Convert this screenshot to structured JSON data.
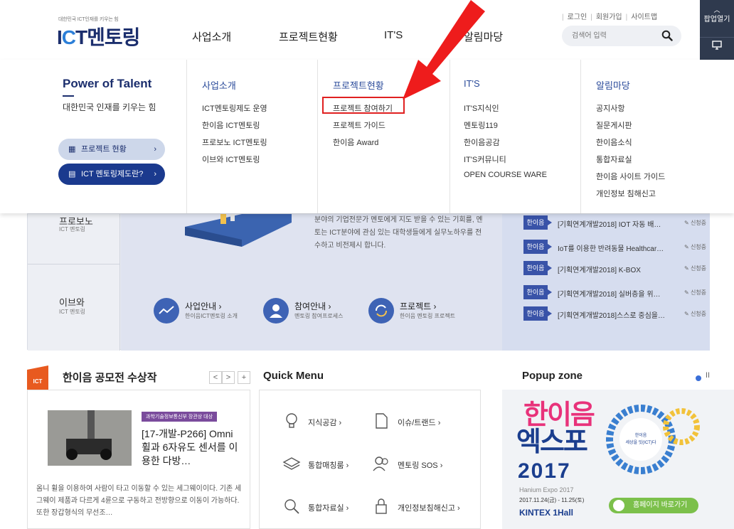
{
  "header": {
    "logo_sub": "대한민국 ICT인재를 키우는 힘",
    "logo_ict_i": "I",
    "logo_ict_c": "C",
    "logo_ict_t": "T",
    "logo_mentoring": "멘토링",
    "gnb": [
      "사업소개",
      "프로젝트현황",
      "IT'S",
      "알림마당"
    ],
    "util": [
      "로그인",
      "회원가입",
      "사이트맵"
    ],
    "search_placeholder": "검색어 입력",
    "popup_open": "팝업열기"
  },
  "mega": {
    "intro_title": "Power of Talent",
    "intro_sub": "대한민국 인재를 키우는 힘",
    "pill_status": "프로젝트 현황",
    "pill_what": "ICT 멘토링제도란?",
    "columns": [
      {
        "title": "사업소개",
        "items": [
          "ICT멘토링제도 운영",
          "한이음 ICT멘토링",
          "프로보노 ICT멘토링",
          "이브와 ICT멘토링"
        ]
      },
      {
        "title": "프로젝트현황",
        "items": [
          "프로젝트 참여하기",
          "프로젝트 가이드",
          "한이음 Award"
        ]
      },
      {
        "title": "IT'S",
        "items": [
          "IT'S지식인",
          "멘토링119",
          "한이음공감",
          "IT'S커뮤니티",
          "OPEN COURSE WARE"
        ]
      },
      {
        "title": "알림마당",
        "items": [
          "공지사항",
          "질문게시판",
          "한이음소식",
          "통합자료실",
          "한이음 사이트 가이드",
          "개인정보 침해신고"
        ]
      }
    ]
  },
  "banner": {
    "probono_title": "프로보노",
    "probono_sub": "ICT 멘토링",
    "eve_title": "이브와",
    "eve_sub": "ICT 멘토링",
    "desc": "분야의 기업전문가 멘토에게 지도 받을 수 있는 기회를, 멘토는 ICT분야에 관심 있는 대학생들에게 실무노하우를 전수하고 비전제시 합니다.",
    "services": [
      {
        "title": "사업안내 ›",
        "sub": "한이음ICT멘토링 소개"
      },
      {
        "title": "참여안내 ›",
        "sub": "멘토링 참여프로세스"
      },
      {
        "title": "프로젝트 ›",
        "sub": "한이음 멘토링 프로젝트"
      }
    ],
    "news": [
      {
        "tag": "한이음",
        "text": "[기획연계개발2018] IOT 자동 배…",
        "status": "신청중"
      },
      {
        "tag": "한이음",
        "text": "IoT를 이용한 반려동물 Healthcar…",
        "status": "신청중"
      },
      {
        "tag": "한이음",
        "text": "[기획연계개발2018] K-BOX",
        "status": "신청중"
      },
      {
        "tag": "한이음",
        "text": "[기획연계개발2018] 실버층을 위…",
        "status": "신청중"
      },
      {
        "tag": "한이음",
        "text": "[기획연계개발2018]스스로 중심을…",
        "status": "신청중"
      }
    ]
  },
  "hanium": {
    "badge": "ICT",
    "title": "한이음 공모전 수상작",
    "nav": [
      "<",
      ">",
      "+"
    ],
    "card_tag": "과학기술정보통신부 장관상 대상",
    "card_title": "[17-개발-P266] Omni 휠과 6자유도 센서를 이용한 다방…",
    "card_desc": "옴니 휠을 이용하여 사람이 타고 이동할 수 있는 세그웨이이다. 기존 세그웨이 제품과 다르게 4륜으로 구동하고 전방향으로 이동이 가능하다. 또한 장갑형식의 무선조…"
  },
  "quick": {
    "title": "Quick Menu",
    "items": [
      {
        "label": "지식공감 ›",
        "icon": "lightbulb-icon"
      },
      {
        "label": "이슈/트랜드 ›",
        "icon": "document-icon"
      },
      {
        "label": "통합매칭룸 ›",
        "icon": "layers-icon"
      },
      {
        "label": "멘토링 SOS ›",
        "icon": "people-icon"
      },
      {
        "label": "통합자료실 ›",
        "icon": "search-icon"
      },
      {
        "label": "개인정보침해신고 ›",
        "icon": "lock-icon"
      }
    ]
  },
  "popup": {
    "title": "Popup zone",
    "pause": "II",
    "expo_han": "한이음",
    "expo_ex": "엑스포",
    "expo_year": "2017",
    "expo_en": "Hanium Expo 2017",
    "expo_date": "2017.11.24(금) - 11.25(토)",
    "expo_venue": "KINTEX 1Hall",
    "ring_text": "한이음 세상을 잇(ICT)다",
    "button": "홈페이지 바로가기"
  },
  "colors": {
    "brand_navy": "#1b2e6d",
    "accent_blue": "#3953a8",
    "highlight_red": "#e02020",
    "orange": "#e85a1f"
  }
}
